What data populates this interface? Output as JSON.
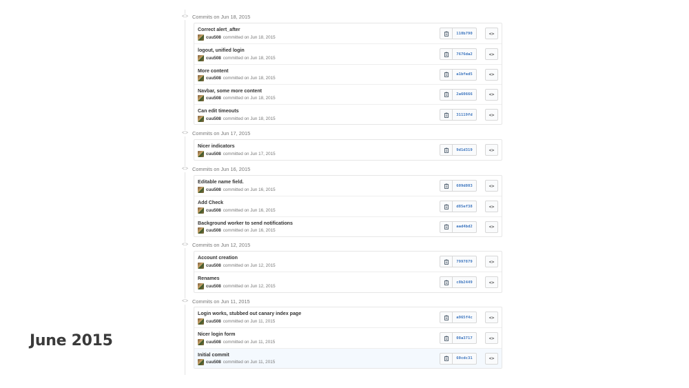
{
  "slide": {
    "title": "June 2015"
  },
  "icons": {
    "copy": "clipboard-icon",
    "browse": "code-icon",
    "timeline": "commit-node-icon"
  },
  "colors": {
    "sha": "#4078c0",
    "highlight_row": "#f4f9fe"
  },
  "labels": {
    "committed_on": "committed on",
    "browse": "<>"
  },
  "days": [
    {
      "label": "Commits on Jun 18, 2015",
      "commits": [
        {
          "message": "Correct alert_after",
          "author": "cuu508",
          "date_text": "committed on Jun 18, 2015",
          "sha": "110b790"
        },
        {
          "message": "logout, unified login",
          "author": "cuu508",
          "date_text": "committed on Jun 18, 2015",
          "sha": "7676da2"
        },
        {
          "message": "More content",
          "author": "cuu508",
          "date_text": "committed on Jun 18, 2015",
          "sha": "a1bfed5"
        },
        {
          "message": "Navbar, some more content",
          "author": "cuu508",
          "date_text": "committed on Jun 18, 2015",
          "sha": "2a60666"
        },
        {
          "message": "Can edit timeouts",
          "author": "cuu508",
          "date_text": "committed on Jun 18, 2015",
          "sha": "31119fd"
        }
      ]
    },
    {
      "label": "Commits on Jun 17, 2015",
      "commits": [
        {
          "message": "Nicer indicators",
          "author": "cuu508",
          "date_text": "committed on Jun 17, 2015",
          "sha": "9d1d319"
        }
      ]
    },
    {
      "label": "Commits on Jun 16, 2015",
      "commits": [
        {
          "message": "Editable name field.",
          "author": "cuu508",
          "date_text": "committed on Jun 16, 2015",
          "sha": "609d803"
        },
        {
          "message": "Add Check",
          "author": "cuu508",
          "date_text": "committed on Jun 16, 2015",
          "sha": "d85ef38"
        },
        {
          "message": "Background worker to send notifications",
          "author": "cuu508",
          "date_text": "committed on Jun 16, 2015",
          "sha": "aad4bd2"
        }
      ]
    },
    {
      "label": "Commits on Jun 12, 2015",
      "commits": [
        {
          "message": "Account creation",
          "author": "cuu508",
          "date_text": "committed on Jun 12, 2015",
          "sha": "7997879"
        },
        {
          "message": "Renames",
          "author": "cuu508",
          "date_text": "committed on Jun 12, 2015",
          "sha": "c8b2449"
        }
      ]
    },
    {
      "label": "Commits on Jun 11, 2015",
      "commits": [
        {
          "message": "Login works, stubbed out canary index page",
          "author": "cuu508",
          "date_text": "committed on Jun 11, 2015",
          "sha": "a965f4c"
        },
        {
          "message": "Nicer login form",
          "author": "cuu508",
          "date_text": "committed on Jun 11, 2015",
          "sha": "08a3717"
        },
        {
          "message": "Initial commit",
          "author": "cuu508",
          "date_text": "committed on Jun 11, 2015",
          "sha": "60cdc31",
          "highlighted": true
        }
      ]
    }
  ]
}
